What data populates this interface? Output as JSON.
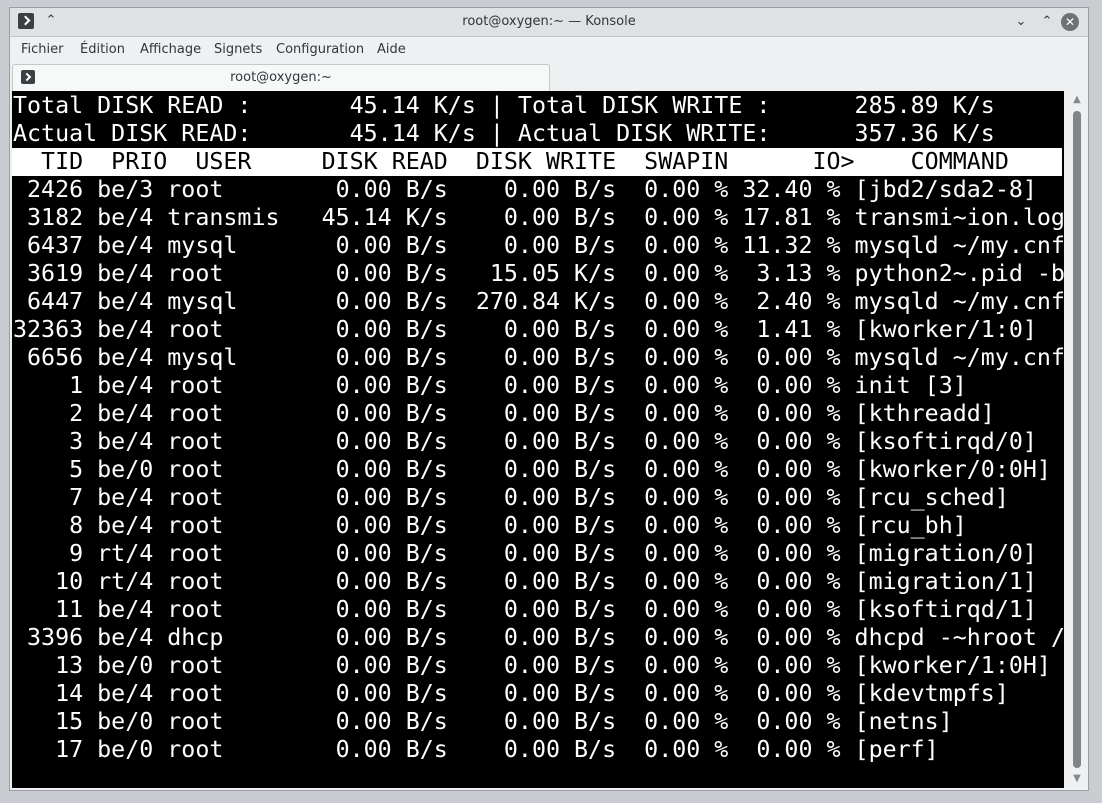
{
  "window": {
    "title": "root@oxygen:~ — Konsole"
  },
  "menu": [
    "Fichier",
    "Édition",
    "Affichage",
    "Signets",
    "Configuration",
    "Aide"
  ],
  "tab": {
    "label": "root@oxygen:~"
  },
  "summary": [
    "Total DISK READ :       45.14 K/s | Total DISK WRITE :      285.89 K/s",
    "Actual DISK READ:       45.14 K/s | Actual DISK WRITE:      357.36 K/s"
  ],
  "header": "  TID  PRIO  USER     DISK READ  DISK WRITE  SWAPIN      IO>    COMMAND",
  "rows": [
    " 2426 be/3 root        0.00 B/s    0.00 B/s  0.00 % 32.40 % [jbd2/sda2-8]",
    " 3182 be/4 transmis   45.14 K/s    0.00 B/s  0.00 % 17.81 % transmi~ion.log",
    " 6437 be/4 mysql       0.00 B/s    0.00 B/s  0.00 % 11.32 % mysqld ~/my.cnf",
    " 3619 be/4 root        0.00 B/s   15.05 K/s  0.00 %  3.13 % python2~.pid -b",
    " 6447 be/4 mysql       0.00 B/s  270.84 K/s  0.00 %  2.40 % mysqld ~/my.cnf",
    "32363 be/4 root        0.00 B/s    0.00 B/s  0.00 %  1.41 % [kworker/1:0]",
    " 6656 be/4 mysql       0.00 B/s    0.00 B/s  0.00 %  0.00 % mysqld ~/my.cnf",
    "    1 be/4 root        0.00 B/s    0.00 B/s  0.00 %  0.00 % init [3]",
    "    2 be/4 root        0.00 B/s    0.00 B/s  0.00 %  0.00 % [kthreadd]",
    "    3 be/4 root        0.00 B/s    0.00 B/s  0.00 %  0.00 % [ksoftirqd/0]",
    "    5 be/0 root        0.00 B/s    0.00 B/s  0.00 %  0.00 % [kworker/0:0H]",
    "    7 be/4 root        0.00 B/s    0.00 B/s  0.00 %  0.00 % [rcu_sched]",
    "    8 be/4 root        0.00 B/s    0.00 B/s  0.00 %  0.00 % [rcu_bh]",
    "    9 rt/4 root        0.00 B/s    0.00 B/s  0.00 %  0.00 % [migration/0]",
    "   10 rt/4 root        0.00 B/s    0.00 B/s  0.00 %  0.00 % [migration/1]",
    "   11 be/4 root        0.00 B/s    0.00 B/s  0.00 %  0.00 % [ksoftirqd/1]",
    " 3396 be/4 dhcp        0.00 B/s    0.00 B/s  0.00 %  0.00 % dhcpd -~hroot /",
    "   13 be/0 root        0.00 B/s    0.00 B/s  0.00 %  0.00 % [kworker/1:0H]",
    "   14 be/4 root        0.00 B/s    0.00 B/s  0.00 %  0.00 % [kdevtmpfs]",
    "   15 be/0 root        0.00 B/s    0.00 B/s  0.00 %  0.00 % [netns]",
    "   17 be/0 root        0.00 B/s    0.00 B/s  0.00 %  0.00 % [perf]"
  ],
  "scrollbar": {
    "position": 0,
    "visible_fraction": 1.0
  },
  "icons": {
    "app": "terminal-icon",
    "keep_above": "double-chevron-up-icon",
    "minimize": "chevron-down-icon",
    "maximize": "chevron-up-icon",
    "close": "close-icon"
  },
  "colors": {
    "terminal_bg": "#000000",
    "terminal_fg": "#ffffff",
    "header_bg": "#ffffff",
    "header_fg": "#000000"
  }
}
